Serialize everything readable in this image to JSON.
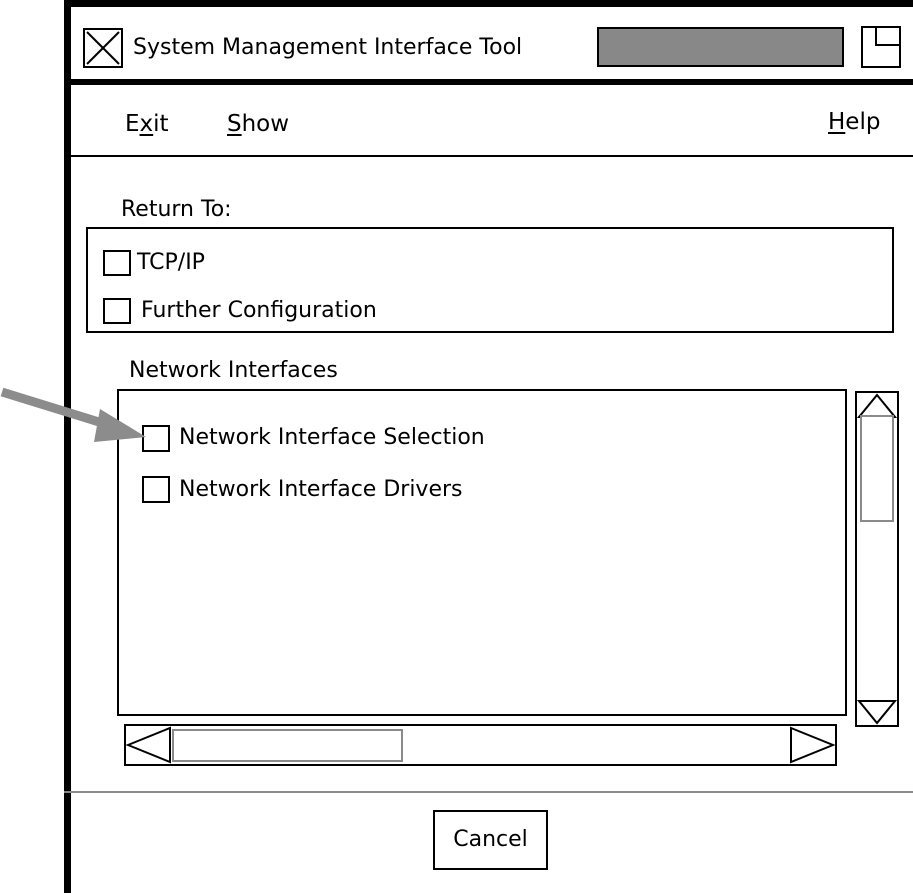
{
  "window": {
    "title": "System Management Interface Tool"
  },
  "menu": {
    "exit": {
      "pre": "E",
      "mnemonic": "x",
      "post": "it"
    },
    "show": {
      "pre": "",
      "mnemonic": "S",
      "post": "how"
    },
    "help": {
      "pre": "",
      "mnemonic": "H",
      "post": "elp"
    }
  },
  "return_to": {
    "label": "Return To:",
    "items": [
      "TCP/IP",
      "Further Configuration"
    ]
  },
  "network_interfaces": {
    "label": "Network Interfaces",
    "items": [
      "Network Interface Selection",
      "Network Interface Drivers"
    ]
  },
  "buttons": {
    "cancel": "Cancel"
  },
  "icons": {
    "close": "close-x-icon",
    "maximize": "window-maximize-icon",
    "callout": "gray-arrow-pointer"
  },
  "colors": {
    "title_bar_fill": "#888888",
    "arrow": "#8c8c8c",
    "scroll_thumb": "#8a8a8a"
  }
}
